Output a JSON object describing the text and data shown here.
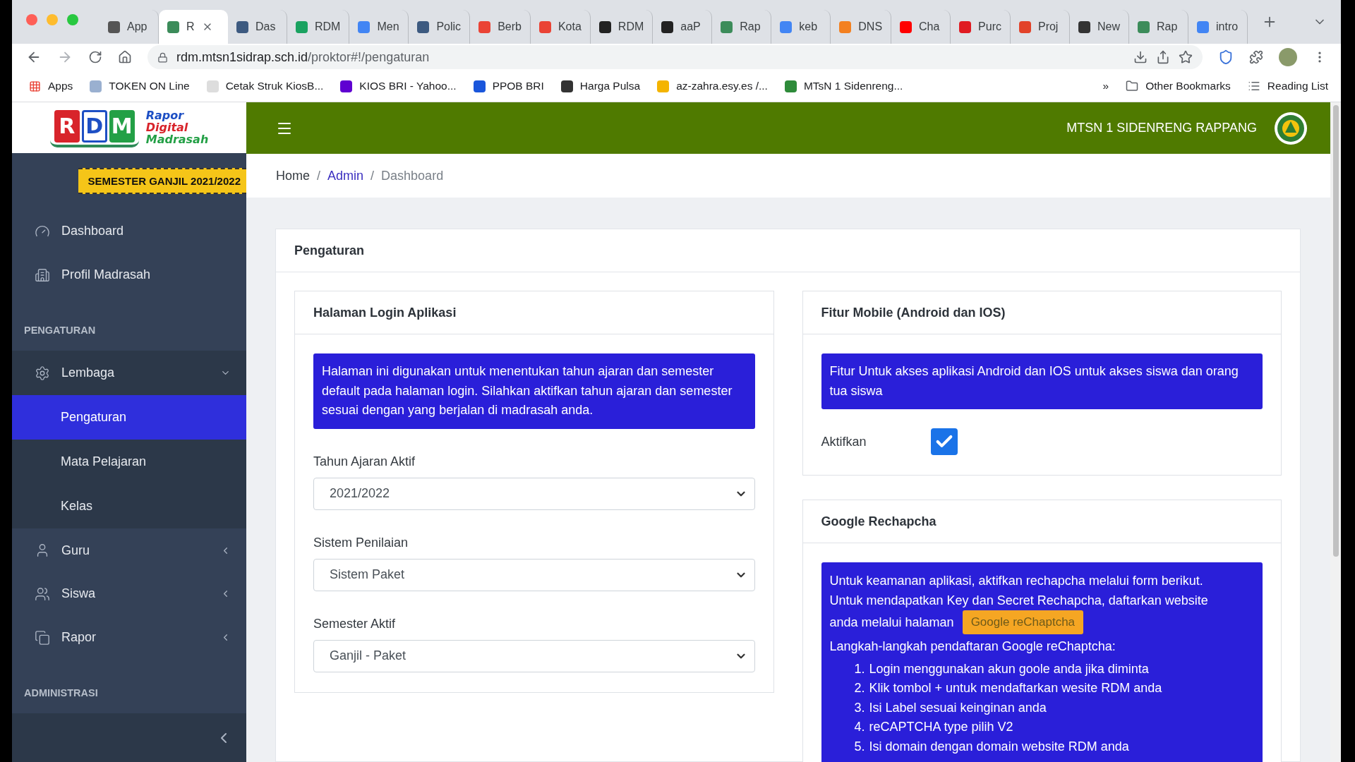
{
  "browser": {
    "tabs": [
      {
        "label": "App",
        "selected": false,
        "color": "#555555"
      },
      {
        "label": "R",
        "selected": true,
        "color": "#3c8c5a"
      },
      {
        "label": "Das",
        "selected": false,
        "color": "#3d5a80"
      },
      {
        "label": "RDM",
        "selected": false,
        "color": "#1aa260"
      },
      {
        "label": "Men",
        "selected": false,
        "color": "#4285f4"
      },
      {
        "label": "Polic",
        "selected": false,
        "color": "#3d5a80"
      },
      {
        "label": "Berb",
        "selected": false,
        "color": "#ea4335"
      },
      {
        "label": "Kota",
        "selected": false,
        "color": "#ea4335"
      },
      {
        "label": "RDM",
        "selected": false,
        "color": "#222222"
      },
      {
        "label": "aaP",
        "selected": false,
        "color": "#222222"
      },
      {
        "label": "Rap",
        "selected": false,
        "color": "#3c8c5a"
      },
      {
        "label": "keb",
        "selected": false,
        "color": "#4285f4"
      },
      {
        "label": "DNS",
        "selected": false,
        "color": "#f38020"
      },
      {
        "label": "Cha",
        "selected": false,
        "color": "#ff0000"
      },
      {
        "label": "Purc",
        "selected": false,
        "color": "#e01b22"
      },
      {
        "label": "Proj",
        "selected": false,
        "color": "#e2432a"
      },
      {
        "label": "New",
        "selected": false,
        "color": "#333333"
      },
      {
        "label": "Rap",
        "selected": false,
        "color": "#3c8c5a"
      },
      {
        "label": "intro",
        "selected": false,
        "color": "#4285f4"
      }
    ],
    "url": {
      "domain": "rdm.mtsn1sidrap.sch.id",
      "path": "/proktor#!/pengaturan"
    },
    "bookmarks": [
      {
        "label": "Apps",
        "color": "#e94235"
      },
      {
        "label": "TOKEN ON Line",
        "color": "#9ab0d0"
      },
      {
        "label": "Cetak Struk KiosB...",
        "color": "#dddddd"
      },
      {
        "label": "KIOS BRI - Yahoo...",
        "color": "#5f01d1"
      },
      {
        "label": "PPOB BRI",
        "color": "#1a56db"
      },
      {
        "label": "Harga Pulsa",
        "color": "#333333"
      },
      {
        "label": "az-zahra.esy.es /...",
        "color": "#f4b400"
      },
      {
        "label": "MTsN 1 Sidenreng...",
        "color": "#2e8b3a"
      }
    ],
    "overflow": "»",
    "other_bookmarks": "Other Bookmarks",
    "reading_list": "Reading List"
  },
  "app": {
    "logo": {
      "letters": [
        "R",
        "D",
        "M"
      ],
      "lines": [
        "Rapor",
        "Digital",
        "Madrasah"
      ]
    },
    "semester_badge": "SEMESTER GANJIL 2021/2022",
    "school_name": "MTSN 1 SIDENRENG RAPPANG",
    "sidebar": [
      {
        "kind": "item",
        "label": "Dashboard",
        "selected": false
      },
      {
        "kind": "item",
        "label": "Profil Madrasah",
        "selected": false
      },
      {
        "kind": "section",
        "label": "PENGATURAN"
      },
      {
        "kind": "group",
        "label": "Lembaga",
        "expanded": true,
        "children": [
          {
            "label": "Pengaturan",
            "selected": true
          },
          {
            "label": "Mata Pelajaran",
            "selected": false
          },
          {
            "label": "Kelas",
            "selected": false
          }
        ]
      },
      {
        "kind": "group",
        "label": "Guru",
        "expanded": false
      },
      {
        "kind": "group",
        "label": "Siswa",
        "expanded": false
      },
      {
        "kind": "group",
        "label": "Rapor",
        "expanded": false
      },
      {
        "kind": "section",
        "label": "ADMINISTRASI"
      }
    ],
    "breadcrumb": [
      {
        "label": "Home",
        "kind": "link"
      },
      {
        "label": "/",
        "kind": "separator"
      },
      {
        "label": "Admin",
        "kind": "active-link"
      },
      {
        "label": "/",
        "kind": "separator"
      },
      {
        "label": "Dashboard",
        "kind": "current"
      }
    ],
    "card_title": "Pengaturan",
    "login_panel": {
      "title": "Halaman Login Aplikasi",
      "alert": "Halaman ini digunakan untuk menentukan tahun ajaran dan semester default pada halaman login. Silahkan aktifkan tahun ajaran dan semester sesuai dengan yang berjalan di madrasah anda.",
      "fields": [
        {
          "label": "Tahun Ajaran Aktif",
          "value": "2021/2022"
        },
        {
          "label": "Sistem Penilaian",
          "value": "Sistem Paket"
        },
        {
          "label": "Semester Aktif",
          "value": "Ganjil - Paket"
        }
      ]
    },
    "mobile_panel": {
      "title": "Fitur Mobile (Android dan IOS)",
      "alert": "Fitur Untuk akses aplikasi Android dan IOS untuk akses siswa dan orang tua siswa",
      "checkbox": {
        "label": "Aktifkan",
        "checked": true
      }
    },
    "recaptcha_panel": {
      "title": "Google Rechapcha",
      "intro_lines": [
        "Untuk keamanan aplikasi, aktifkan rechapcha melalui form berikut.",
        "Untuk mendapatkan Key dan Secret Rechapcha, daftarkan website",
        "anda melalui halaman"
      ],
      "button": "Google reChaptcha",
      "steps_title": "Langkah-langkah pendaftaran Google reChaptcha:",
      "steps": [
        {
          "number": "1.",
          "text": "Login menggunakan akun goole anda jika diminta"
        },
        {
          "number": "2.",
          "text": "Klik tombol + untuk mendaftarkan wesite RDM anda"
        },
        {
          "number": "3.",
          "text": "Isi Label sesuai keinginan anda"
        },
        {
          "number": "4.",
          "text": "reCAPTCHA type pilih V2"
        },
        {
          "number": "5.",
          "text": "Isi domain dengan domain website RDM anda"
        }
      ]
    }
  }
}
